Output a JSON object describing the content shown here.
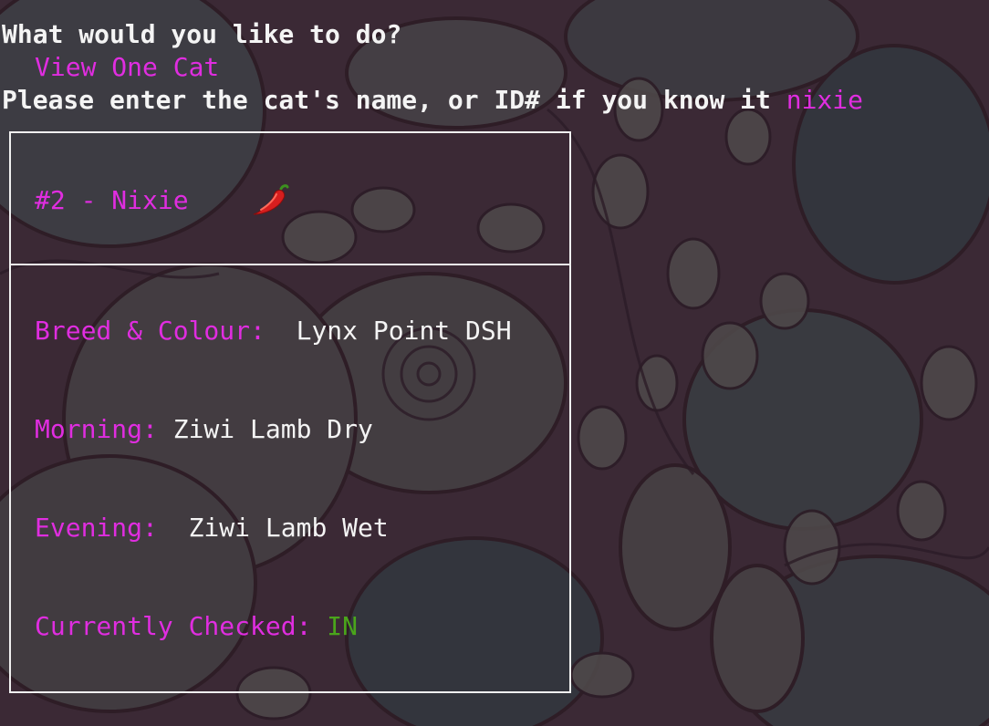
{
  "prompt": {
    "question": "What would you like to do?",
    "selected_option": "View One Cat",
    "name_request": "Please enter the cat's name, or ID# if you know it ",
    "entered_name": "nixie"
  },
  "cat": {
    "header": "#2 - Nixie",
    "header_icon": "chili-pepper-icon",
    "breed_label": "Breed & Colour:",
    "breed_value": "Lynx Point DSH",
    "morning_label": "Morning:",
    "morning_value": "Ziwi Lamb Dry",
    "evening_label": "Evening:",
    "evening_value": "Ziwi Lamb Wet",
    "checked_label": "Currently Checked:",
    "checked_value": "IN"
  },
  "colors": {
    "prompt_text": "#f4f4f4",
    "accent_magenta": "#e02de0",
    "status_in_green": "#4aa51b",
    "background": "#3a2a36"
  }
}
